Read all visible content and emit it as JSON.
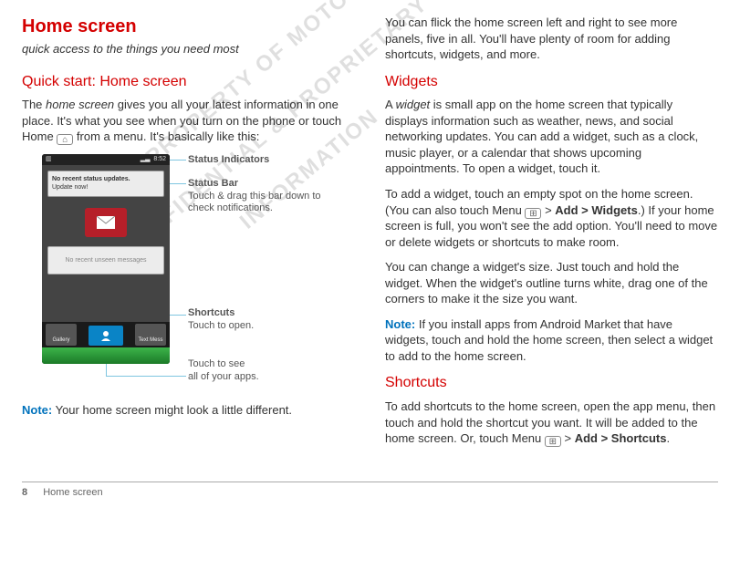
{
  "title": "Home screen",
  "subtitle": "quick access to the things you need most",
  "section1_heading": "Quick start: Home screen",
  "section1_p1a": "The ",
  "section1_p1_em": "home screen",
  "section1_p1b": " gives you all your latest information in one place. It's what you see when you turn on the phone or touch Home ",
  "section1_p1c": " from a menu. It's basically like this:",
  "note_label": "Note:",
  "note_text": " Your home screen might look a little different.",
  "right_p1": "You can flick the home screen left and right to see more panels, five in all. You'll have plenty of room for adding shortcuts, widgets, and more.",
  "widgets_heading": "Widgets",
  "widgets_p1a": "A ",
  "widgets_p1_em": "widget",
  "widgets_p1b": " is small app on the home screen that typically displays information such as weather, news, and social networking updates. You can add a widget, such as a clock, music player, or a calendar that shows upcoming appointments. To open a widget, touch it.",
  "widgets_p2a": "To add a widget, touch an empty spot on the home screen. (You can also touch Menu ",
  "widgets_p2b": " > ",
  "widgets_p2_bold1": "Add > Widgets",
  "widgets_p2c": ".) If your home screen is full, you won't see the add option. You'll need to move or delete widgets or shortcuts to make room.",
  "widgets_p3": "You can change a widget's size. Just touch and hold the widget. When the widget's outline turns white, drag one of the corners to make it the size you want.",
  "widgets_note": " If you install apps from Android Market that have widgets, touch and hold the home screen, then select a widget to add to the home screen.",
  "shortcuts_heading": "Shortcuts",
  "shortcuts_p1a": "To add shortcuts to the home screen, open the app menu, then touch and hold the shortcut you want. It will be added to the home screen. Or, touch Menu ",
  "shortcuts_p1b": " > ",
  "shortcuts_p1_bold": "Add > Shortcuts",
  "shortcuts_p1c": ".",
  "page_number": "8",
  "page_label": "Home screen",
  "phone": {
    "time": "8:52",
    "status_notif1": "No recent status updates.",
    "status_notif2": "Update now!",
    "msg_widget": "No recent unseen messages",
    "dock_app1": "Gallery",
    "dock_app2": "Text Mess"
  },
  "callouts": {
    "status_indicators": "Status Indicators",
    "status_bar_title": "Status Bar",
    "status_bar_desc": "Touch & drag this bar down to check notifications.",
    "shortcuts_title": "Shortcuts",
    "shortcuts_desc": "Touch to open.",
    "apps_desc": "Touch to see\nall of your apps."
  },
  "watermark": "DRAFT - PROPERTY OF MOTOROLA - CONFIDENTIAL & PROPRIETARY INFORMATION"
}
